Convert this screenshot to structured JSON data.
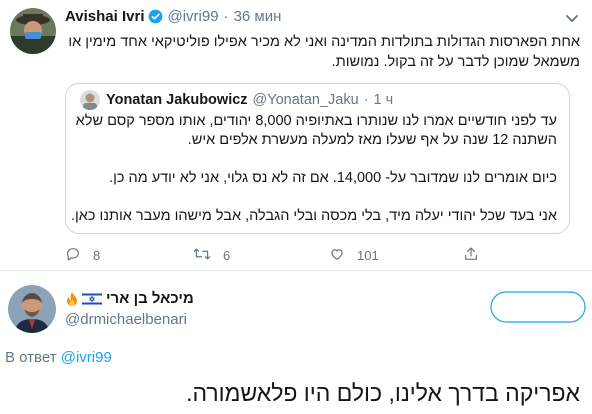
{
  "tweet": {
    "author_name": "Avishai Ivri",
    "handle": "@ivri99",
    "separator": "·",
    "time": "36 мин",
    "text_line1": "אחת הפארסות הגדולות בתולדות המדינה ואני לא מכיר אפילו פוליטיקאי אחד מימין או",
    "text_line2": "משמאל שמוכן לדבר על זה בקול. נמושות.",
    "quote": {
      "author_name": "Yonatan Jakubowicz",
      "handle": "@Yonatan_Jaku",
      "separator": "·",
      "time": "1 ч",
      "line1": "עד לפני חודשיים אמרו לנו שנותרו באתיופיה 8,000 יהודים, אותו מספר קסם שלא",
      "line2": "השתנה 12 שנה על אף שעלו מאז למעלה מעשרת אלפים  איש.",
      "line3": "כיום אומרים לנו שמדובר על- 14,000. אם זה לא נס גלוי, אני לא יודע מה כן.",
      "line4": "אני בעד שכל יהודי יעלה מיד, בלי מכסה ובלי הגבלה, אבל מישהו מעבר אותנו כאן."
    },
    "actions": {
      "replies": "8",
      "retweets": "6",
      "likes": "101"
    }
  },
  "reply": {
    "author_name": "מיכאל בן ארי",
    "handle": "@drmichaelbenari",
    "in_reply_label": "В ответ",
    "in_reply_handle": "@ivri99",
    "text": "אפריקה בדרך אלינו, כולם היו פלאשמורה."
  },
  "icons": {
    "verified": "verified-badge-icon",
    "caret": "chevron-down-icon",
    "reply": "reply-icon",
    "retweet": "retweet-icon",
    "like": "heart-icon",
    "share": "share-icon",
    "flag": "israel-flag-icon",
    "fire": "fire-icon"
  },
  "colors": {
    "accent": "#1da1f2",
    "muted": "#657786",
    "border": "#e6ecf0"
  }
}
